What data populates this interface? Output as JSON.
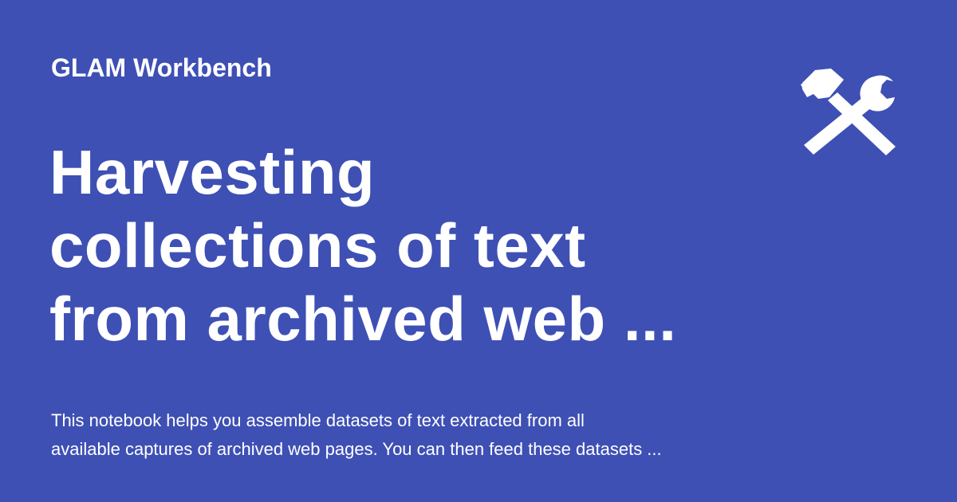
{
  "site": {
    "name": "GLAM Workbench"
  },
  "title_lines": [
    "Harvesting",
    "collections of text",
    "from archived web ..."
  ],
  "description_lines": [
    "This notebook helps you assemble datasets of text extracted from all",
    "available captures of archived web pages. You can then feed these datasets ..."
  ],
  "logo": {
    "icon": "hammer-and-wrench-icon"
  },
  "colors": {
    "background": "#3e50b4",
    "text": "#ffffff"
  }
}
